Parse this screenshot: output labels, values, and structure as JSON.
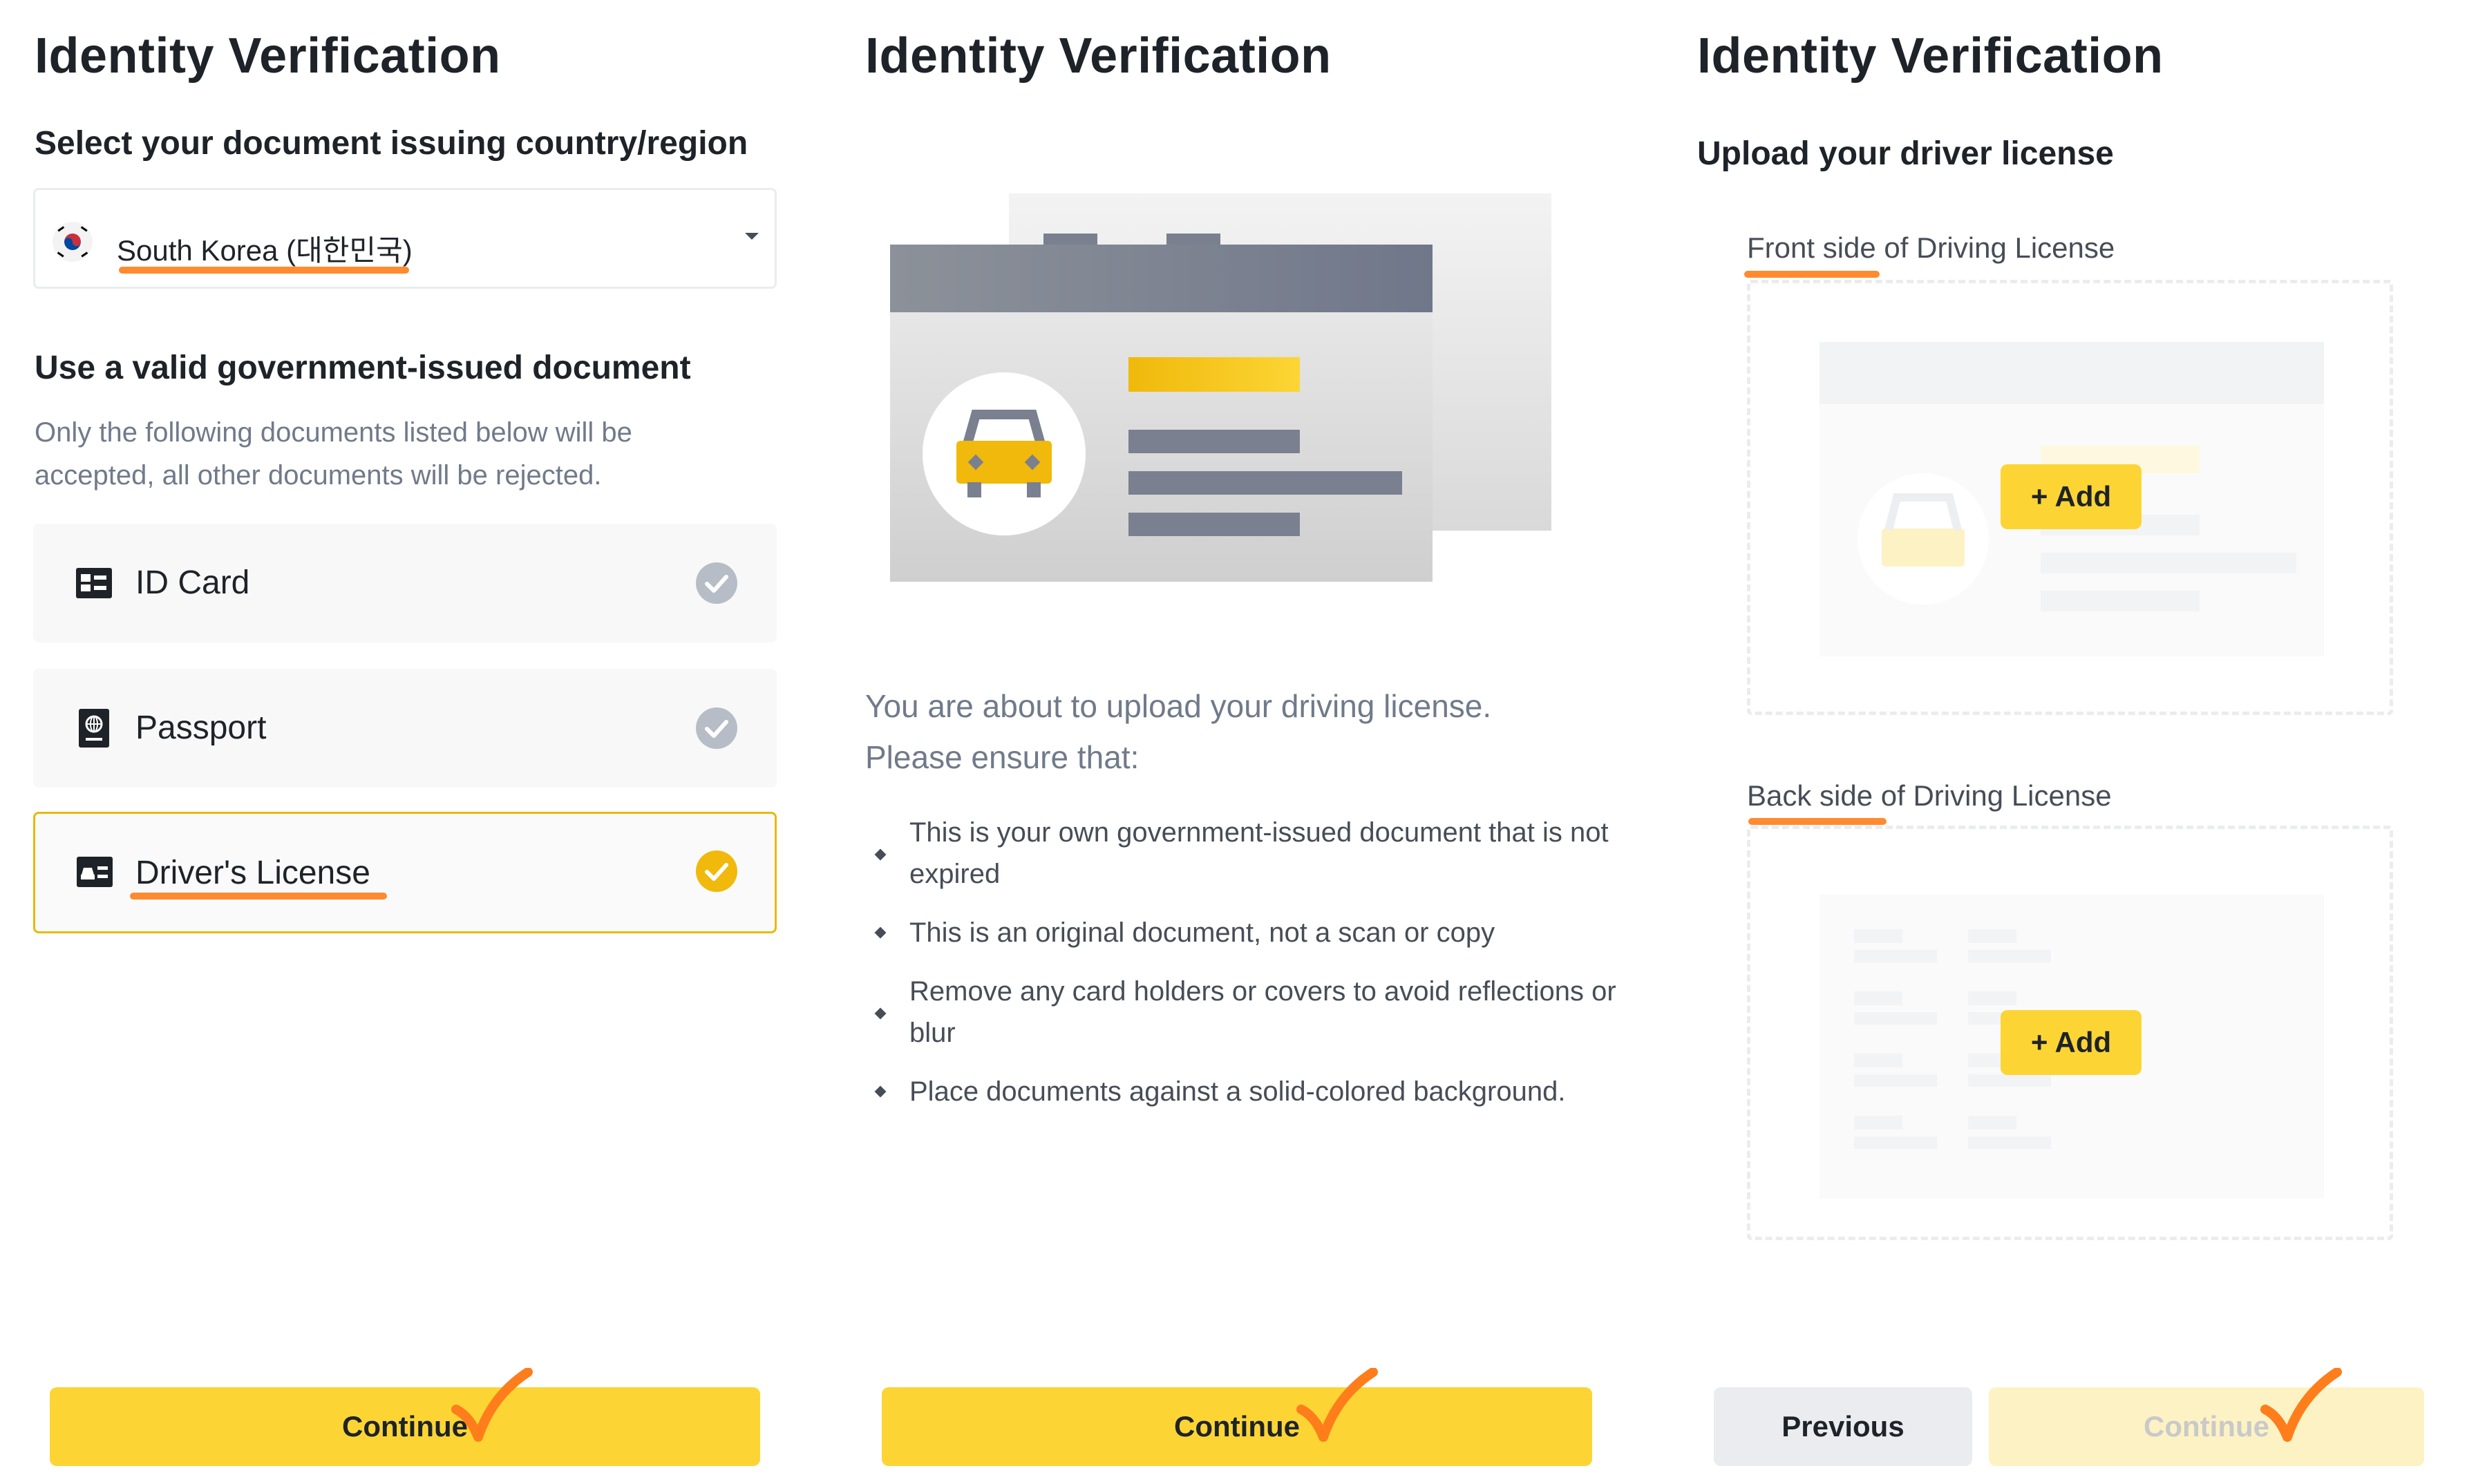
{
  "panel1": {
    "title": "Identity Verification",
    "country_heading": "Select your document issuing country/region",
    "country_value": "South Korea (대한민국)",
    "doc_heading": "Use a valid government-issued document",
    "doc_note_line1": "Only the following documents listed below will be",
    "doc_note_line2": "accepted, all other documents will be rejected.",
    "documents": [
      {
        "label": "ID Card",
        "icon": "id-card-icon",
        "selected": false
      },
      {
        "label": "Passport",
        "icon": "passport-icon",
        "selected": false
      },
      {
        "label": "Driver's License",
        "icon": "drivers-license-icon",
        "selected": true
      }
    ],
    "continue_label": "Continue"
  },
  "panel2": {
    "title": "Identity Verification",
    "intro_line1": "You are about to upload your driving license.",
    "intro_line2": "Please ensure that:",
    "bullets": [
      "This is your own government-issued document that is not expired",
      "This is an original document, not a scan or copy",
      "Remove any card holders or covers to avoid reflections or blur",
      "Place documents against a solid-colored background."
    ],
    "continue_label": "Continue"
  },
  "panel3": {
    "title": "Identity Verification",
    "heading": "Upload your driver license",
    "front_label": "Front side of Driving License",
    "back_label": "Back side of Driving License",
    "add_label": "+ Add",
    "previous_label": "Previous",
    "continue_label": "Continue"
  },
  "colors": {
    "brand_yellow": "#fcd535",
    "annotation_orange": "#ff7d1a",
    "selected_border": "#e8b90c"
  }
}
